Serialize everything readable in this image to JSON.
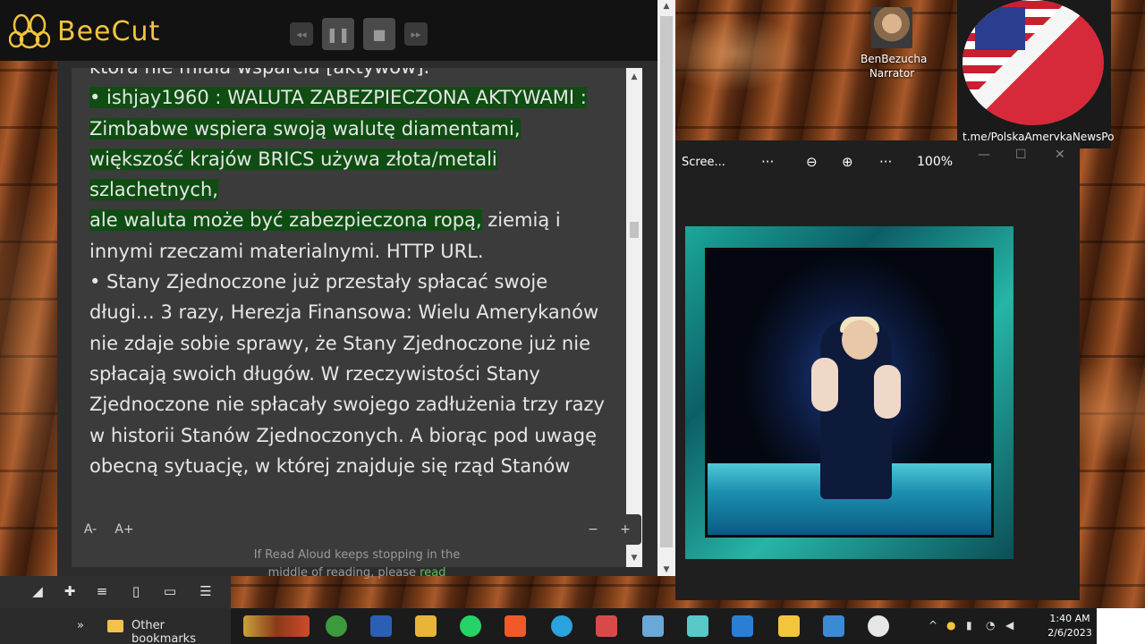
{
  "app": {
    "name": "BeeCut"
  },
  "reader": {
    "paragraphs": [
      {
        "id": "p0",
        "text": "która nie miała wsparcia [aktywów].",
        "highlight": false
      },
      {
        "id": "p1",
        "text": "• ishjay1960 : WALUTA ZABEZPIECZONA AKTYWAMI : Zimbabwe wspiera swoją walutę diamentami, większość krajów BRICS używa złota/metali szlachetnych,",
        "highlight": true
      },
      {
        "id": "p2a",
        "text": "ale waluta może być zabezpieczona ropą,",
        "highlight": true
      },
      {
        "id": "p2b",
        "text": " ziemią i innymi rzeczami materialnymi. HTTP URL.",
        "highlight": false
      },
      {
        "id": "p3",
        "text": "• Stany Zjednoczone już przestały spłacać swoje długi… 3 razy, Herezja Finansowa: Wielu Amerykanów nie zdaje sobie sprawy, że Stany Zjednoczone już nie spłacają swoich długów. W rzeczywistości Stany Zjednoczone nie spłacały swojego zadłużenia trzy razy w historii Stanów Zjednoczonych. A biorąc pod uwagę obecną sytuację, w której znajduje się rząd Stanów",
        "highlight": false
      }
    ],
    "font_decrease": "A-",
    "font_increase": "A+",
    "zoom_minus": "−",
    "zoom_plus": "+",
    "note_text": "If Read Aloud keeps stopping in the middle of reading, please",
    "note_link": "read"
  },
  "desktop": {
    "icon_label_line1": "BenBezucha",
    "icon_label_line2": "Narrator",
    "flag_link": "t.me/PolskaAmerykaNewsPo"
  },
  "viewer": {
    "title": "Scree...",
    "more1": "···",
    "more2": "···",
    "zoom_out": "⊖",
    "zoom_in": "⊕",
    "zoom_level": "100%",
    "minimize": "—",
    "maximize": "☐",
    "close": "✕"
  },
  "browser": {
    "more_label": "»",
    "bookmark_folder": "Other bookmarks"
  },
  "taskbar": {
    "time": "1:40 AM",
    "date": "2/6/2023",
    "chevron": "^"
  }
}
